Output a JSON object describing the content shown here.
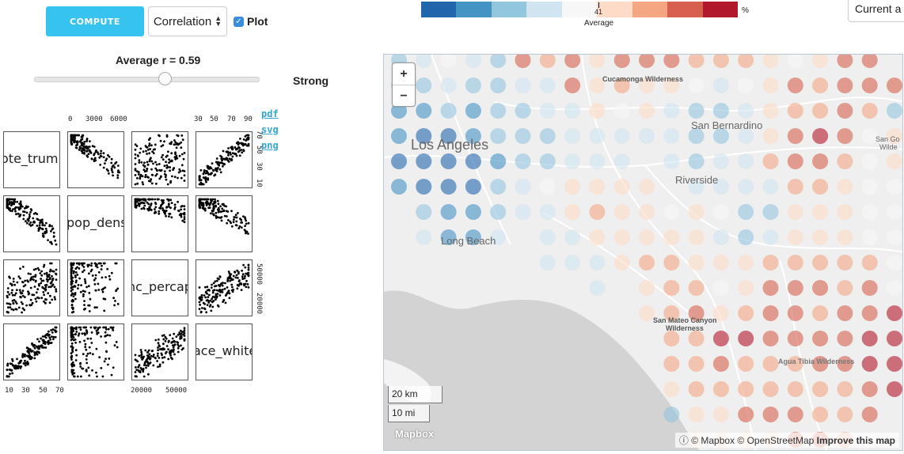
{
  "controls": {
    "compute_label": "COMPUTE",
    "method_select": "Correlation",
    "plot_checkbox_label": "Plot",
    "plot_checked": true,
    "average_label": "Average r = 0.59",
    "strength_label": "Strong",
    "slider_value": 0.59
  },
  "scatter_matrix": {
    "variables": [
      "vote_trump",
      "pop_dens",
      "inc_percap",
      "race_white"
    ],
    "visible_labels": [
      "ote_trum",
      "pop_dens",
      "nc_percap",
      "ace_white"
    ],
    "top_ticks_col2": [
      "0",
      "3000",
      "6000"
    ],
    "top_ticks_col4": [
      "30",
      "50",
      "70",
      "90"
    ],
    "right_ticks_row1": [
      "10",
      "30",
      "50",
      "70"
    ],
    "right_ticks_row3": [
      "20000",
      "50000"
    ],
    "bottom_ticks_col1": [
      "10",
      "30",
      "50",
      "70"
    ],
    "bottom_ticks_col3": [
      "20000",
      "50000"
    ],
    "links": [
      "pdf",
      "svg",
      "png"
    ]
  },
  "legend": {
    "colors": [
      "#2166ac",
      "#4393c3",
      "#92c5de",
      "#d1e5f0",
      "#f7f7f7",
      "#fddbc7",
      "#f4a582",
      "#d6604d",
      "#b2182b"
    ],
    "marker_value": "41",
    "unit": "%",
    "caption": "Average"
  },
  "current_field": "Current a",
  "map": {
    "zoom_in": "+",
    "zoom_out": "−",
    "labels": {
      "cucamonga": "Cucamonga Wilderness",
      "san_bernardino": "San Bernardino",
      "los_angeles": "Los Angeles",
      "riverside": "Riverside",
      "long_beach": "Long Beach",
      "san_gorgonio_1": "San Go",
      "san_gorgonio_2": "Wilde",
      "san_mateo_1": "San Mateo Canyon",
      "san_mateo_2": "Wilderness",
      "agua_tibia": "Agua Tibia Wilderness"
    },
    "scale_km": "20 km",
    "scale_mi": "10 mi",
    "logo": "Mapbox",
    "attribution_info": "ⓘ",
    "attribution": "© Mapbox © OpenStreetMap",
    "improve_link": "Improve this map",
    "dot_grid": [
      [
        2,
        3,
        4,
        3,
        2,
        7,
        6,
        7,
        5,
        7,
        7,
        7,
        6,
        6,
        6,
        5,
        4,
        5,
        7,
        7,
        -1
      ],
      [
        2,
        2,
        3,
        2,
        2,
        3,
        3,
        7,
        5,
        6,
        5,
        5,
        4,
        3,
        4,
        5,
        7,
        6,
        7,
        7,
        7
      ],
      [
        1,
        1,
        2,
        1,
        2,
        2,
        3,
        3,
        5,
        4,
        5,
        3,
        2,
        2,
        3,
        5,
        6,
        6,
        7,
        6,
        2
      ],
      [
        1,
        0,
        0,
        1,
        2,
        2,
        2,
        3,
        3,
        3,
        3,
        3,
        2,
        2,
        3,
        5,
        7,
        8,
        7,
        4,
        5
      ],
      [
        0,
        0,
        0,
        0,
        1,
        2,
        2,
        3,
        3,
        3,
        -1,
        3,
        2,
        3,
        3,
        6,
        7,
        7,
        6,
        4,
        5
      ],
      [
        1,
        0,
        0,
        0,
        2,
        3,
        4,
        5,
        5,
        5,
        5,
        -1,
        3,
        3,
        3,
        3,
        6,
        6,
        5,
        4,
        4
      ],
      [
        -1,
        2,
        1,
        1,
        2,
        3,
        3,
        5,
        6,
        5,
        5,
        4,
        5,
        4,
        2,
        2,
        5,
        5,
        5,
        4,
        4
      ],
      [
        -1,
        3,
        1,
        1,
        3,
        -1,
        3,
        3,
        5,
        5,
        5,
        5,
        5,
        3,
        2,
        3,
        5,
        5,
        5,
        4,
        4
      ],
      [
        -1,
        -1,
        -1,
        -1,
        -1,
        -1,
        3,
        3,
        3,
        5,
        6,
        6,
        5,
        5,
        5,
        6,
        6,
        6,
        6,
        6,
        4
      ],
      [
        -1,
        -1,
        -1,
        -1,
        -1,
        -1,
        -1,
        -1,
        3,
        -1,
        5,
        6,
        6,
        4,
        5,
        7,
        7,
        7,
        6,
        7,
        4
      ],
      [
        -1,
        -1,
        -1,
        -1,
        -1,
        -1,
        -1,
        -1,
        -1,
        -1,
        5,
        6,
        7,
        5,
        6,
        7,
        7,
        6,
        7,
        7,
        8
      ],
      [
        -1,
        -1,
        -1,
        -1,
        -1,
        -1,
        -1,
        -1,
        -1,
        -1,
        -1,
        6,
        6,
        8,
        8,
        7,
        7,
        7,
        7,
        8,
        8
      ],
      [
        -1,
        -1,
        -1,
        -1,
        -1,
        -1,
        -1,
        -1,
        -1,
        -1,
        -1,
        6,
        6,
        7,
        6,
        6,
        6,
        7,
        7,
        8,
        8
      ],
      [
        -1,
        -1,
        -1,
        -1,
        -1,
        -1,
        -1,
        -1,
        -1,
        -1,
        -1,
        5,
        6,
        6,
        6,
        6,
        6,
        6,
        6,
        7,
        8
      ],
      [
        -1,
        -1,
        -1,
        -1,
        -1,
        -1,
        -1,
        -1,
        -1,
        -1,
        -1,
        2,
        5,
        5,
        7,
        7,
        7,
        6,
        6,
        7,
        -1
      ],
      [
        -1,
        -1,
        -1,
        -1,
        -1,
        -1,
        -1,
        -1,
        -1,
        -1,
        -1,
        -1,
        5,
        5,
        5,
        5,
        7,
        7,
        6,
        -1,
        -1
      ]
    ]
  }
}
